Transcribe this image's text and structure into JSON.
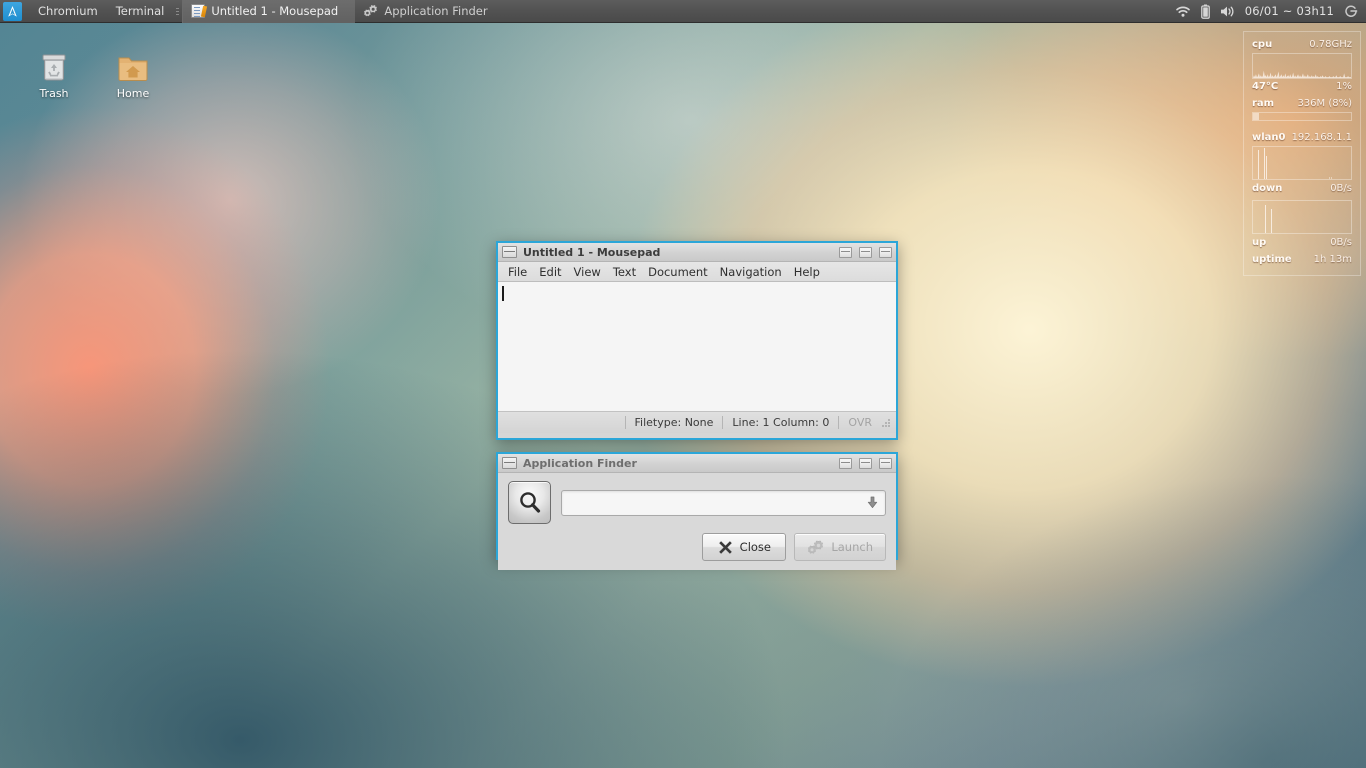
{
  "panel": {
    "logo_icon": "arch-logo-icon",
    "launchers": [
      {
        "label": "Chromium",
        "name": "launcher-chromium"
      },
      {
        "label": "Terminal",
        "name": "launcher-terminal"
      }
    ],
    "tasks": [
      {
        "label": "Untitled 1 - Mousepad",
        "icon": "mousepad-icon",
        "active": true
      },
      {
        "label": "Application Finder",
        "icon": "gears-icon",
        "active": false
      }
    ],
    "tray": {
      "wifi_icon": "wifi-icon",
      "battery_icon": "battery-icon",
      "volume_icon": "speaker-icon",
      "clock": "06/01 ~ 03h11",
      "power_icon": "power-icon"
    }
  },
  "desktop": {
    "icons": [
      {
        "label": "Trash",
        "icon": "trash-icon"
      },
      {
        "label": "Home",
        "icon": "home-folder-icon"
      }
    ]
  },
  "mousepad": {
    "title": "Untitled 1 - Mousepad",
    "menu": [
      "File",
      "Edit",
      "View",
      "Text",
      "Document",
      "Navigation",
      "Help"
    ],
    "editor_text": "",
    "status": {
      "filetype": "Filetype: None",
      "position": "Line: 1 Column: 0",
      "overwrite": "OVR"
    },
    "window_buttons": [
      "minimize-button",
      "maximize-button",
      "close-button"
    ]
  },
  "appfinder": {
    "title": "Application Finder",
    "search_icon": "magnifier-icon",
    "search_value": "",
    "search_placeholder": "",
    "dropdown_icon": "arrow-down-icon",
    "close_label": "Close",
    "close_icon": "close-x-icon",
    "launch_label": "Launch",
    "launch_icon": "gears-icon",
    "launch_disabled": true,
    "window_buttons": [
      "minimize-button",
      "maximize-button",
      "close-button"
    ]
  },
  "conky": {
    "cpu": {
      "key": "cpu",
      "value": "0.78GHz"
    },
    "cpu_temp": {
      "key": "47°C",
      "value": "1%"
    },
    "ram": {
      "key": "ram",
      "value": "336M (8%)"
    },
    "wlan": {
      "key": "wlan0",
      "value": "192.168.1.1"
    },
    "down": {
      "key": "down",
      "value": "0B/s"
    },
    "up": {
      "key": "up",
      "value": "0B/s"
    },
    "uptime": {
      "key": "uptime",
      "value": "1h 13m"
    }
  },
  "colors": {
    "panel_bg": "#525252",
    "window_border_active": "#2ba6d8",
    "window_bg": "#d6d6d6",
    "editor_bg": "#f5f5f5"
  }
}
